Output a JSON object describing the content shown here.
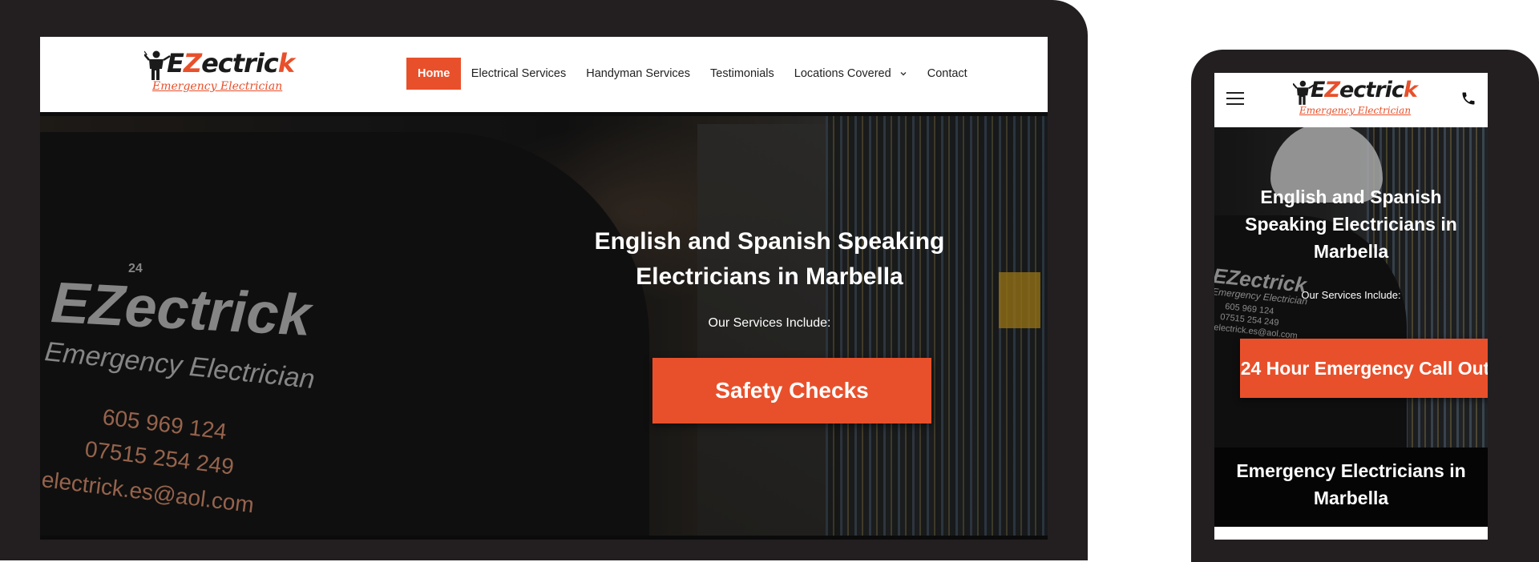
{
  "brand": {
    "logo_word_a": "E",
    "logo_word_b": "Z",
    "logo_word_c": "ectric",
    "logo_word_d": "k",
    "logo_tagline": "Emergency Electrician",
    "accent_color": "#e8502b"
  },
  "desktop": {
    "nav": {
      "items": [
        {
          "label": "Home",
          "active": true
        },
        {
          "label": "Electrical Services"
        },
        {
          "label": "Handyman Services"
        },
        {
          "label": "Testimonials"
        },
        {
          "label": "Locations Covered",
          "has_dropdown": true
        },
        {
          "label": "Contact"
        }
      ]
    },
    "hero": {
      "title_line1_bold1": "English",
      "title_line1_mid": " and ",
      "title_line1_bold2": "Spanish",
      "title_line1_end": " Speaking",
      "title_line2_bold1": "Electricians",
      "title_line2_mid": " in ",
      "title_line2_bold2": "Marbella",
      "subtitle": "Our Services Include:",
      "cta_label": "Safety Checks"
    },
    "shirt_print": {
      "brand": "EZectrick",
      "tagline": "Emergency Electrician",
      "phone1": "605 969 124",
      "phone2": "07515 254 249",
      "email": "electrick.es@aol.com",
      "badge": "24"
    }
  },
  "mobile": {
    "icons": {
      "menu": "hamburger-menu-icon",
      "phone": "phone-icon"
    },
    "hero": {
      "title_bold1": "English",
      "title_mid1": " and ",
      "title_bold2": "Spanish",
      "title_plain": "Speaking ",
      "title_bold3": "Electricians",
      "title_mid2": " in",
      "title_bold4": "Marbella",
      "subtitle": "Our Services Include:",
      "cta_label": "24 Hour Emergency Call Out"
    },
    "section": {
      "title_bold1": "Emergency Electricians",
      "title_mid": " in",
      "title_bold2": "Marbella"
    },
    "shirt_print": {
      "brand": "EZectrick",
      "tagline": "Emergency Electrician",
      "phone1": "605 969 124",
      "phone2": "07515 254 249",
      "email": "electrick.es@aol.com"
    }
  }
}
